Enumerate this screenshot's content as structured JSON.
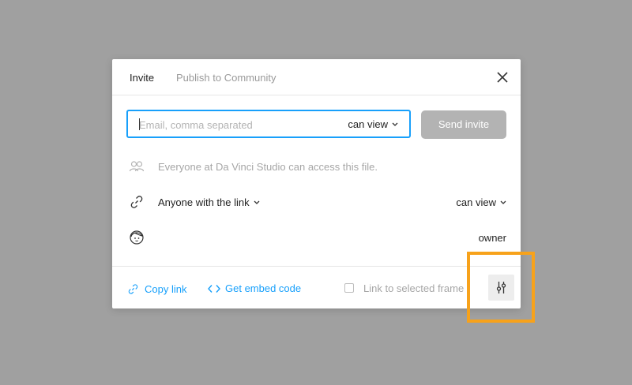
{
  "header": {
    "tabs": [
      {
        "label": "Invite",
        "active": true
      },
      {
        "label": "Publish to Community",
        "active": false
      }
    ]
  },
  "invite": {
    "email_placeholder": "Email, comma separated",
    "email_value": "",
    "permission": "can view",
    "send_label": "Send invite"
  },
  "access": {
    "team_text": "Everyone at Da Vinci Studio can access this file.",
    "link_scope": "Anyone with the link",
    "link_permission": "can view",
    "owner_role": "owner"
  },
  "footer": {
    "copy_link": "Copy link",
    "embed_code": "Get embed code",
    "link_selected": "Link to selected frame"
  },
  "icons": {
    "close": "close-icon",
    "team": "people-icon",
    "link": "link-icon",
    "avatar": "avatar-icon",
    "code": "code-icon",
    "settings": "sliders-icon"
  },
  "colors": {
    "accent": "#18a0fb",
    "disabled_button": "#b3b3b3",
    "highlight": "#f7a21b",
    "backdrop": "#a0a0a0"
  }
}
